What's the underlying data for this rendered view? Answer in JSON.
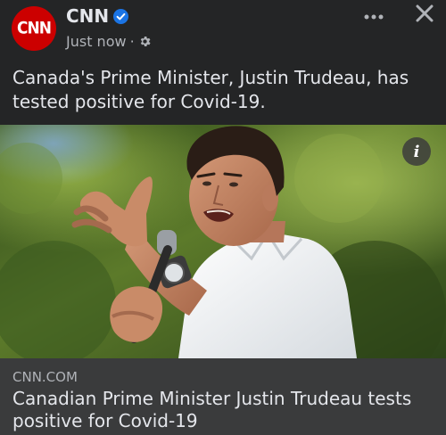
{
  "header": {
    "page_name": "CNN",
    "avatar_text": "CNN",
    "timestamp": "Just now",
    "separator": "·",
    "verified_icon": "verified-badge-icon",
    "privacy_icon": "gear-icon",
    "more_icon": "more-options-icon",
    "close_icon": "close-icon"
  },
  "post": {
    "text": "Canada's Prime Minister, Justin Trudeau, has tested positive for Covid-19."
  },
  "image": {
    "info_icon": "info-icon",
    "info_glyph": "i"
  },
  "link_preview": {
    "domain": "CNN.COM",
    "title": "Canadian Prime Minister Justin Trudeau tests positive for Covid-19"
  },
  "colors": {
    "background": "#242526",
    "preview_background": "#3a3b3c",
    "brand_red": "#cc0000",
    "verified_blue": "#1b74e4"
  }
}
